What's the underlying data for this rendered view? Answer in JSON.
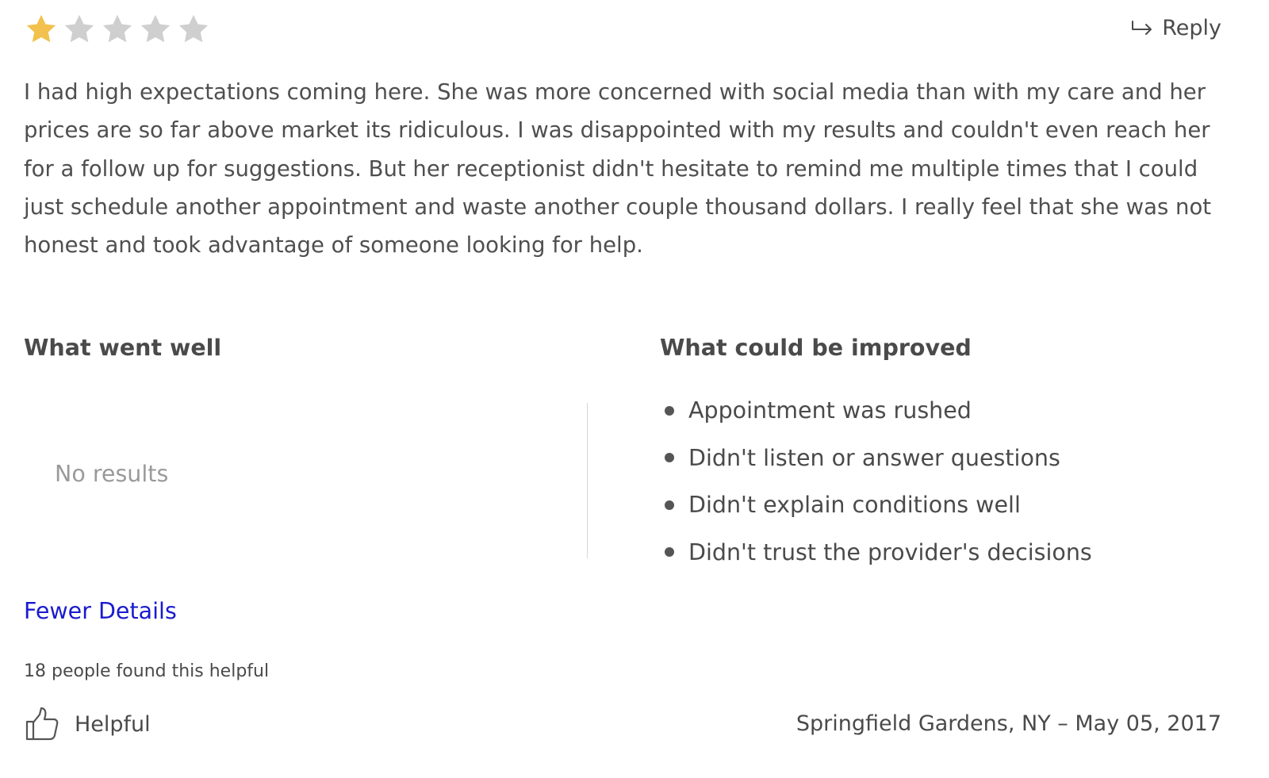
{
  "rating": {
    "value": 1,
    "max": 5,
    "filled_color": "#f2c14e",
    "empty_color": "#cfcfcf"
  },
  "reply": {
    "icon": "reply-arrow-icon",
    "label": "Reply"
  },
  "review": {
    "text": "I had high expectations coming here. She was more concerned with social media than with my care and her prices are so far above market its ridiculous. I was disappointed with my results and couldn't even reach her for a follow up for suggestions. But her receptionist didn't hesitate to remind me multiple times that I could just schedule another appointment and waste another couple thousand dollars. I really feel that she was not honest and took advantage of someone looking for help."
  },
  "went_well": {
    "title": "What went well",
    "empty_text": "No results"
  },
  "improved": {
    "title": "What could be improved",
    "items": [
      "Appointment was rushed",
      "Didn't listen or answer questions",
      "Didn't explain conditions well",
      "Didn't trust the provider's decisions"
    ]
  },
  "details_toggle": {
    "label": "Fewer Details",
    "color": "#1a1acf"
  },
  "helpful": {
    "count_text": "18 people found this helpful",
    "button_label": "Helpful",
    "icon": "thumbs-up-icon"
  },
  "meta": {
    "location_date": "Springfield Gardens, NY – May 05, 2017"
  }
}
